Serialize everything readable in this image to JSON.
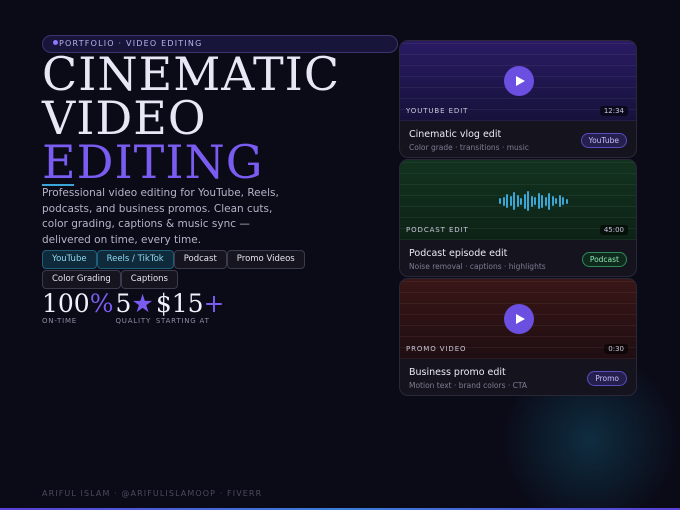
{
  "kicker": "PORTFOLIO · VIDEO EDITING",
  "hero": {
    "line1": "CINEMATIC",
    "line2": "VIDEO",
    "line3": "EDITING"
  },
  "description": "Professional video editing for YouTube, Reels, podcasts, and business promos. Clean cuts, color grading, captions & music sync — delivered on time, every time.",
  "chips": [
    {
      "label": "YouTube",
      "highlight": true
    },
    {
      "label": "Reels / TikTok",
      "highlight": true
    },
    {
      "label": "Podcast",
      "highlight": false
    },
    {
      "label": "Promo Videos",
      "highlight": false
    },
    {
      "label": "Color Grading",
      "highlight": false
    },
    {
      "label": "Captions",
      "highlight": false
    }
  ],
  "stats": [
    {
      "value": "100",
      "accent": "%",
      "label": "ON-TIME"
    },
    {
      "value": "5",
      "accent": "★",
      "label": "QUALITY"
    },
    {
      "value": "$15",
      "accent": "+",
      "label": "STARTING AT"
    }
  ],
  "footer": "ARIFUL ISLAM · @ARIFULISLAMOOP · FIVERR",
  "cards": [
    {
      "type_label": "YOUTUBE EDIT",
      "duration": "12:34",
      "title": "Cinematic vlog edit",
      "subtitle": "Color grade · transitions · music",
      "badge": "YouTube",
      "media": "play-icon",
      "colors": {
        "thumb_top": "#2a1b63",
        "thumb_bottom": "#16123b",
        "badge_bg": "#241f4d",
        "badge_border": "#5a4cc0",
        "badge_text": "#c9c0ff"
      }
    },
    {
      "type_label": "PODCAST EDIT",
      "duration": "45:00",
      "title": "Podcast episode edit",
      "subtitle": "Noise removal · captions · highlights",
      "badge": "Podcast",
      "media": "waveform-icon",
      "colors": {
        "thumb_top": "#12331f",
        "thumb_bottom": "#0d2216",
        "badge_bg": "#0f2a1d",
        "badge_border": "#2f8a5a",
        "badge_text": "#8ee6b3"
      }
    },
    {
      "type_label": "PROMO VIDEO",
      "duration": "0:30",
      "title": "Business promo edit",
      "subtitle": "Motion text · brand colors · CTA",
      "badge": "Promo",
      "media": "play-icon",
      "colors": {
        "thumb_top": "#3a1616",
        "thumb_bottom": "#1f0e12",
        "badge_bg": "#241f4d",
        "badge_border": "#5a4cc0",
        "badge_text": "#c9c0ff"
      }
    }
  ]
}
